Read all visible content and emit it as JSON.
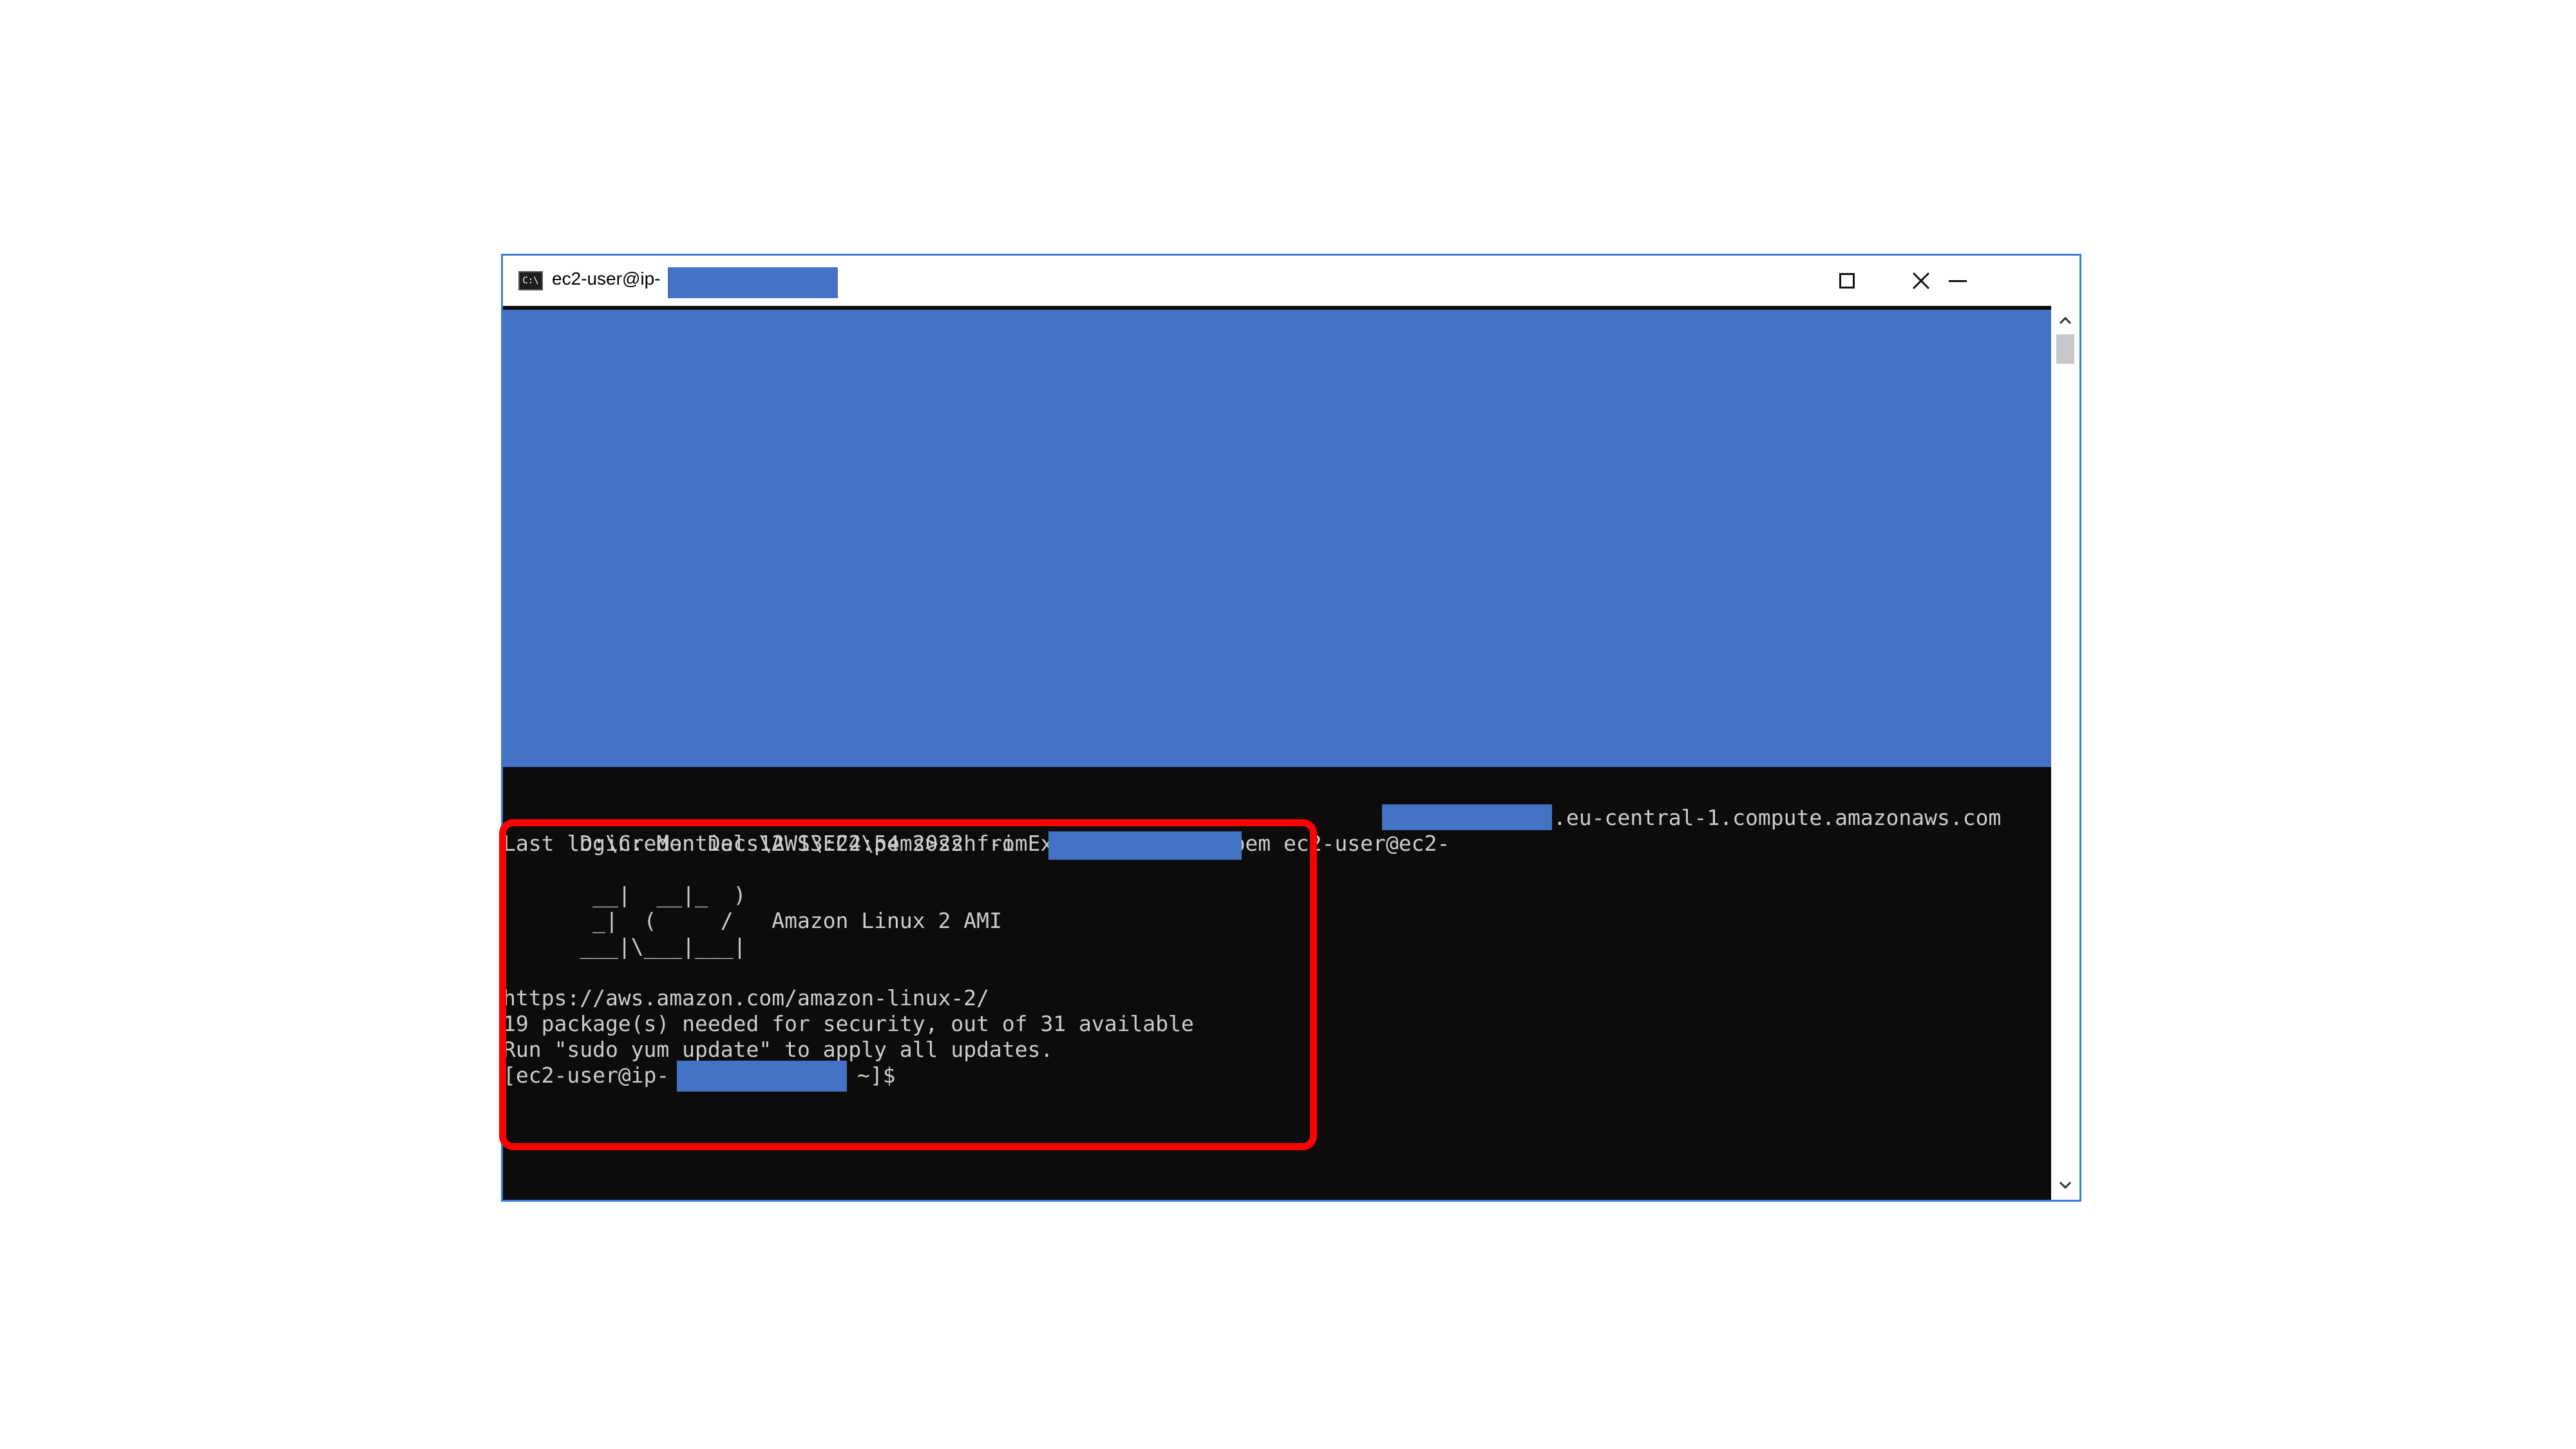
{
  "window": {
    "title": "ec2-user@ip-",
    "app_icon_text": "C:\\",
    "controls": {
      "minimize_icon": "minimize-icon",
      "maximize_icon": "maximize-icon",
      "close_icon": "close-icon"
    }
  },
  "terminal": {
    "ssh_command_prefix": "D:\\Credentials\\AWS\\EC2\\pems>ssh -i ExampleInstance.pem ec2-user@ec2-",
    "ssh_command_suffix": ".eu-central-1.compute.amazonaws.com",
    "last_login": "Last login: Mon Dec 12 13:24:54 2022 from",
    "banner_line1": "       __|  __|_  )",
    "banner_line2": "       _|  (     /   Amazon Linux 2 AMI",
    "banner_line3": "      ___|\\___|___|",
    "url_line": "https://aws.amazon.com/amazon-linux-2/",
    "packages_line": "19 package(s) needed for security, out of 31 available",
    "update_line": "Run \"sudo yum update\" to apply all updates.",
    "prompt_prefix": "[ec2-user@ip-",
    "prompt_suffix": "~]$"
  },
  "colors": {
    "redaction": "#4472c4",
    "highlight": "#ff0000",
    "console_bg": "#0c0c0c",
    "console_text": "#cccccc"
  }
}
